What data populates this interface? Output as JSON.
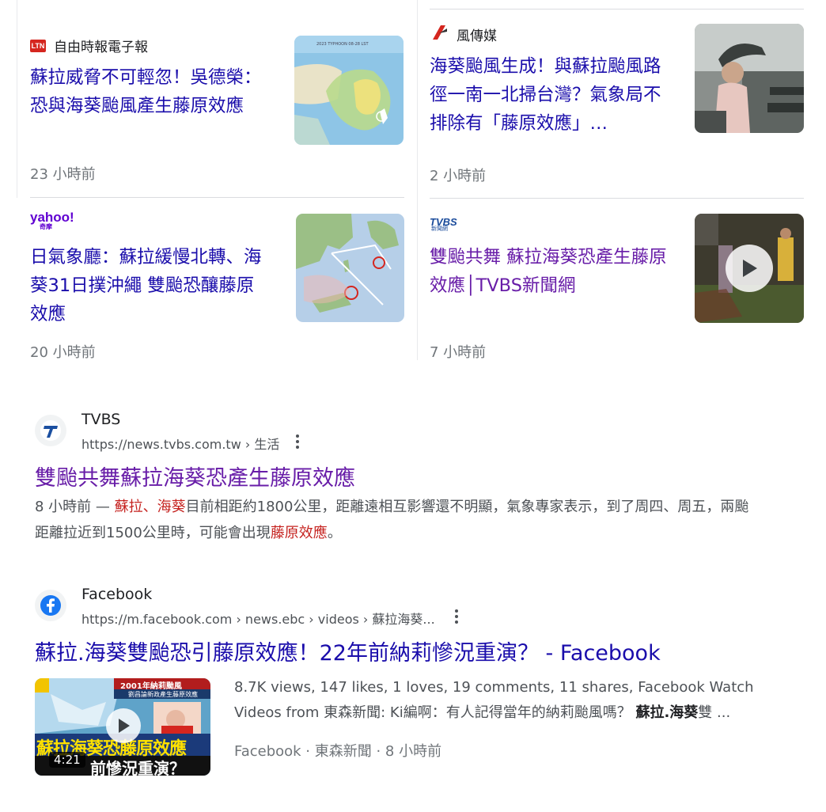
{
  "top_stories": [
    {
      "source": "自由時報電子報",
      "source_logo_text": "LTN",
      "title": "蘇拉威脅不可輕忽！吳德榮： 恐與海葵颱風產生藤原效應",
      "time": "23 小時前",
      "visited": false
    },
    {
      "source": "風傳媒",
      "title": "海葵颱風生成！與蘇拉颱風路徑一南一北掃台灣？氣象局不排除有「藤原效應」…",
      "time": "2 小時前",
      "visited": false
    },
    {
      "source": "yahoo!",
      "source_sub": "奇摩",
      "title": "日氣象廳：蘇拉緩慢北轉、海葵31日撲沖繩 雙颱恐釀藤原效應",
      "time": "20 小時前",
      "visited": false
    },
    {
      "source": "TVBS",
      "source_sub": "新聞網",
      "title": "雙颱共舞 蘇拉海葵恐產生藤原效應│TVBS新聞網",
      "time": "7 小時前",
      "visited": true
    }
  ],
  "results": [
    {
      "site": "TVBS",
      "url": "https://news.tvbs.com.tw › 生活",
      "title": "雙颱共舞蘇拉海葵恐產生藤原效應",
      "snippet": {
        "date": "8 小時前 — ",
        "hl1": "蘇拉",
        "sep": "、",
        "hl2": "海葵",
        "text1": "目前相距約1800公里，距離遠相互影響還不明顯，氣象專家表示，到了周四、周五，兩颱距離拉近到1500公里時，可能會出現",
        "hl3": "藤原效應",
        "text2": "。"
      }
    },
    {
      "site": "Facebook",
      "url": "https://m.facebook.com › news.ebc › videos › 蘇拉海葵...",
      "title": "蘇拉.海葵雙颱恐引藤原效應！22年前納莉慘況重演？ - Facebook",
      "video": {
        "stats": "8.7K views, 147 likes, 1 loves, 19 comments, 11 shares, Facebook Watch",
        "desc_plain": "Videos from 東森新聞: Ki編啊：有人記得當年的納莉颱風嗎？ ",
        "desc_bold": "蘇拉.海葵",
        "desc_tail": "雙 ...",
        "meta": "Facebook · 東森新聞 · 8 小時前",
        "duration": "4:21",
        "thumb_top": "2001年納莉颱風",
        "thumb_sub": "劉昌論新政產生藤原效應",
        "thumb_main": "蘇拉海葵恐藤原效應",
        "thumb_bottom": "前慘況重演？"
      }
    }
  ],
  "icons": {
    "more": "more-vert-icon",
    "play": "play-icon"
  },
  "colors": {
    "link": "#1a0dab",
    "visited": "#681da8",
    "highlight": "#c5221f",
    "meta": "#70757a"
  }
}
